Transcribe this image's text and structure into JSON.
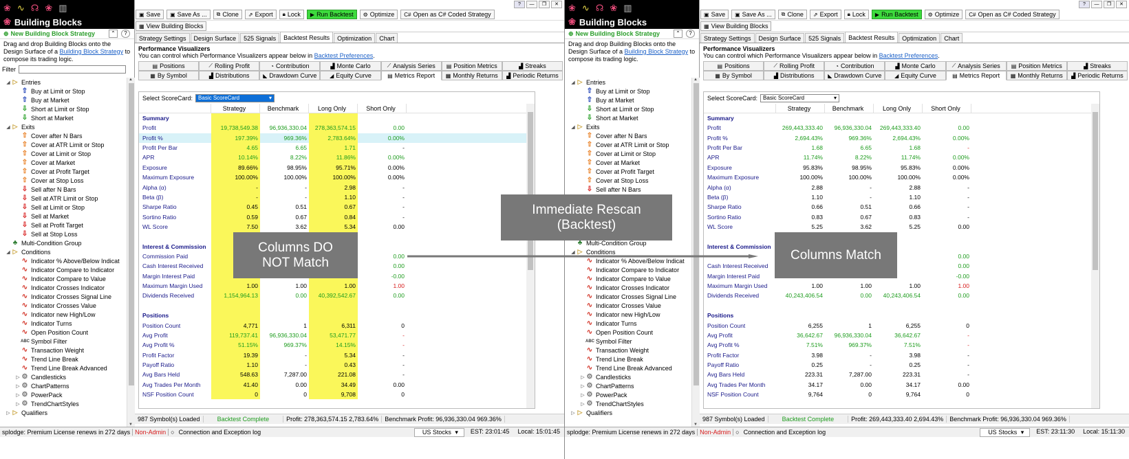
{
  "bb": {
    "title": "Building Blocks",
    "new_label": "New Building Block Strategy",
    "desc_pre": "Drag and drop Building Blocks onto the Design Surface of a ",
    "desc_link": "Building Block Strategy",
    "desc_post": " to compose its trading logic.",
    "filter_label": "Filter",
    "tree": [
      {
        "t": "Entries",
        "i": "folder",
        "e": "open",
        "l": 0
      },
      {
        "t": "Buy at Limit or Stop",
        "i": "up",
        "l": 1
      },
      {
        "t": "Buy at Market",
        "i": "up",
        "l": 1
      },
      {
        "t": "Short at Limit or Stop",
        "i": "dn",
        "l": 1
      },
      {
        "t": "Short at Market",
        "i": "dn",
        "l": 1
      },
      {
        "t": "Exits",
        "i": "folder",
        "e": "open",
        "l": 0
      },
      {
        "t": "Cover after N Bars",
        "i": "or",
        "l": 1
      },
      {
        "t": "Cover at ATR Limit or Stop",
        "i": "or",
        "l": 1
      },
      {
        "t": "Cover at Limit or Stop",
        "i": "or",
        "l": 1
      },
      {
        "t": "Cover at Market",
        "i": "or",
        "l": 1
      },
      {
        "t": "Cover at Profit Target",
        "i": "or",
        "l": 1
      },
      {
        "t": "Cover at Stop Loss",
        "i": "or",
        "l": 1
      },
      {
        "t": "Sell after N Bars",
        "i": "rd",
        "l": 1
      },
      {
        "t": "Sell at ATR Limit or Stop",
        "i": "rd",
        "l": 1
      },
      {
        "t": "Sell at Limit or Stop",
        "i": "rd",
        "l": 1
      },
      {
        "t": "Sell at Market",
        "i": "rd",
        "l": 1
      },
      {
        "t": "Sell at Profit Target",
        "i": "rd",
        "l": 1
      },
      {
        "t": "Sell at Stop Loss",
        "i": "rd",
        "l": 1
      },
      {
        "t": "Multi-Condition Group",
        "i": "gr",
        "l": 0
      },
      {
        "t": "Conditions",
        "i": "folder",
        "e": "open",
        "l": 0
      },
      {
        "t": "Indicator % Above/Below Indicat",
        "i": "sq",
        "l": 1
      },
      {
        "t": "Indicator Compare to Indicator",
        "i": "sq",
        "l": 1
      },
      {
        "t": "Indicator Compare to Value",
        "i": "sq",
        "l": 1
      },
      {
        "t": "Indicator Crosses Indicator",
        "i": "sq",
        "l": 1
      },
      {
        "t": "Indicator Crosses Signal Line",
        "i": "sq",
        "l": 1
      },
      {
        "t": "Indicator Crosses Value",
        "i": "sq",
        "l": 1
      },
      {
        "t": "Indicator new High/Low",
        "i": "sq",
        "l": 1
      },
      {
        "t": "Indicator Turns",
        "i": "sq",
        "l": 1
      },
      {
        "t": "Open Position Count",
        "i": "sq",
        "l": 1
      },
      {
        "t": "Symbol Filter",
        "i": "abc",
        "l": 1
      },
      {
        "t": "Transaction Weight",
        "i": "sq",
        "l": 1
      },
      {
        "t": "Trend Line Break",
        "i": "sq",
        "l": 1
      },
      {
        "t": "Trend Line Break Advanced",
        "i": "sq",
        "l": 1
      },
      {
        "t": "Candlesticks",
        "i": "gear",
        "e": "closed",
        "l": 1
      },
      {
        "t": "ChartPatterns",
        "i": "gear",
        "e": "closed",
        "l": 1
      },
      {
        "t": "PowerPack",
        "i": "gear",
        "e": "closed",
        "l": 1
      },
      {
        "t": "TrendChartStyles",
        "i": "gear",
        "e": "closed",
        "l": 1
      },
      {
        "t": "Qualifiers",
        "i": "folder",
        "e": "closed",
        "l": 0
      }
    ]
  },
  "toolbar": {
    "save": "Save",
    "save_as": "Save As ...",
    "clone": "Clone",
    "export": "Export",
    "lock": "Lock",
    "run": "Run Backtest",
    "optimize": "Optimize",
    "open_cs": "Open as C# Coded Strategy",
    "view_bb": "View Building Blocks"
  },
  "tabs": {
    "t0": "Strategy Settings",
    "t1": "Design Surface",
    "t2": "525 Signals",
    "t3": "Backtest Results",
    "t4": "Optimization",
    "t5": "Chart"
  },
  "pv": {
    "title": "Performance Visualizers",
    "desc_pre": "You can control which Performance Visualizers appear below in ",
    "desc_link": "Backtest Preferences",
    "desc_post": "."
  },
  "mtabs1": {
    "a": "Positions",
    "b": "Rolling Profit",
    "c": "Contribution",
    "d": "Monte Carlo",
    "e": "Analysis Series",
    "f": "Position Metrics",
    "g": "Streaks"
  },
  "mtabs2": {
    "a": "By Symbol",
    "b": "Distributions",
    "c": "Drawdown Curve",
    "d": "Equity Curve",
    "e": "Metrics Report",
    "f": "Monthly Returns",
    "g": "Periodic Returns"
  },
  "scorecard": {
    "label": "Select ScoreCard:",
    "value": "Basic ScoreCard"
  },
  "cols": {
    "c1": "Strategy",
    "c2": "Benchmark",
    "c3": "Long Only",
    "c4": "Short Only"
  },
  "rows_left": [
    {
      "n": "Summary",
      "s": 1
    },
    {
      "n": "Profit",
      "v": [
        "19,738,549.38",
        "96,936,330.04",
        "278,363,574.15",
        "0.00"
      ],
      "c": [
        "g",
        "g",
        "g",
        "g"
      ]
    },
    {
      "n": "Profit %",
      "v": [
        "197.39%",
        "969.36%",
        "2,783.64%",
        "0.00%"
      ],
      "c": [
        "g",
        "g",
        "g",
        "g"
      ]
    },
    {
      "n": "Profit Per Bar",
      "v": [
        "4.65",
        "6.65",
        "1.71",
        "-"
      ],
      "c": [
        "g",
        "g",
        "g",
        "k"
      ]
    },
    {
      "n": "APR",
      "v": [
        "10.14%",
        "8.22%",
        "11.86%",
        "0.00%"
      ],
      "c": [
        "g",
        "g",
        "g",
        "g"
      ]
    },
    {
      "n": "Exposure",
      "v": [
        "89.66%",
        "98.95%",
        "95.71%",
        "0.00%"
      ],
      "c": [
        "k",
        "k",
        "k",
        "k"
      ]
    },
    {
      "n": "Maximum Exposure",
      "v": [
        "100.00%",
        "100.00%",
        "100.00%",
        "0.00%"
      ],
      "c": [
        "k",
        "k",
        "k",
        "k"
      ]
    },
    {
      "n": "Alpha (α)",
      "v": [
        "-",
        "-",
        "2.98",
        "-"
      ],
      "c": [
        "k",
        "k",
        "k",
        "k"
      ]
    },
    {
      "n": "Beta (β)",
      "v": [
        "-",
        "-",
        "1.10",
        "-"
      ],
      "c": [
        "k",
        "k",
        "k",
        "k"
      ]
    },
    {
      "n": "Sharpe Ratio",
      "v": [
        "0.45",
        "0.51",
        "0.67",
        "-"
      ],
      "c": [
        "k",
        "k",
        "k",
        "k"
      ]
    },
    {
      "n": "Sortino Ratio",
      "v": [
        "0.59",
        "0.67",
        "0.84",
        "-"
      ],
      "c": [
        "k",
        "k",
        "k",
        "k"
      ]
    },
    {
      "n": "WL Score",
      "v": [
        "7.50",
        "3.62",
        "5.34",
        "0.00"
      ],
      "c": [
        "k",
        "k",
        "k",
        "k"
      ]
    },
    {
      "n": "",
      "b": 1
    },
    {
      "n": "Interest & Commission",
      "s": 1
    },
    {
      "n": "Commission Paid",
      "v": [
        "",
        "",
        "",
        "0.00"
      ],
      "c": [
        "g",
        "g",
        "g",
        "g"
      ]
    },
    {
      "n": "Cash Interest Received",
      "v": [
        "",
        "",
        "",
        "0.00"
      ],
      "c": [
        "g",
        "g",
        "g",
        "g"
      ]
    },
    {
      "n": "Margin Interest Paid",
      "v": [
        "",
        "",
        "",
        "-0.00"
      ],
      "c": [
        "g",
        "g",
        "g",
        "g"
      ]
    },
    {
      "n": "Maximum Margin Used",
      "v": [
        "1.00",
        "1.00",
        "1.00",
        "1.00"
      ],
      "c": [
        "k",
        "k",
        "k",
        "r"
      ]
    },
    {
      "n": "Dividends Received",
      "v": [
        "1,154,964.13",
        "0.00",
        "40,392,542.67",
        "0.00"
      ],
      "c": [
        "g",
        "g",
        "g",
        "g"
      ]
    },
    {
      "n": "",
      "b": 1
    },
    {
      "n": "Positions",
      "s": 1
    },
    {
      "n": "Position Count",
      "v": [
        "4,771",
        "1",
        "6,311",
        "0"
      ],
      "c": [
        "k",
        "k",
        "k",
        "k"
      ]
    },
    {
      "n": "Avg Profit",
      "v": [
        "119,737.41",
        "96,936,330.04",
        "53,471.77",
        "-"
      ],
      "c": [
        "g",
        "g",
        "g",
        "r"
      ]
    },
    {
      "n": "Avg Profit %",
      "v": [
        "51.15%",
        "969.37%",
        "14.15%",
        "-"
      ],
      "c": [
        "g",
        "g",
        "g",
        "r"
      ]
    },
    {
      "n": "Profit Factor",
      "v": [
        "19.39",
        "-",
        "5.34",
        "-"
      ],
      "c": [
        "k",
        "k",
        "k",
        "k"
      ]
    },
    {
      "n": "Payoff Ratio",
      "v": [
        "1.10",
        "-",
        "0.43",
        "-"
      ],
      "c": [
        "k",
        "k",
        "k",
        "k"
      ]
    },
    {
      "n": "Avg Bars Held",
      "v": [
        "548.63",
        "7,287.00",
        "221.08",
        "-"
      ],
      "c": [
        "k",
        "k",
        "k",
        "k"
      ]
    },
    {
      "n": "Avg Trades Per Month",
      "v": [
        "41.40",
        "0.00",
        "34.49",
        "0.00"
      ],
      "c": [
        "k",
        "k",
        "k",
        "k"
      ]
    },
    {
      "n": "NSF Position Count",
      "v": [
        "0",
        "0",
        "9,708",
        "0"
      ],
      "c": [
        "k",
        "k",
        "k",
        "k"
      ]
    }
  ],
  "rows_right": [
    {
      "n": "Summary",
      "s": 1
    },
    {
      "n": "Profit",
      "v": [
        "269,443,333.40",
        "96,936,330.04",
        "269,443,333.40",
        "0.00"
      ],
      "c": [
        "g",
        "g",
        "g",
        "g"
      ]
    },
    {
      "n": "Profit %",
      "v": [
        "2,694.43%",
        "969.36%",
        "2,694.43%",
        "0.00%"
      ],
      "c": [
        "g",
        "g",
        "g",
        "g"
      ]
    },
    {
      "n": "Profit Per Bar",
      "v": [
        "1.68",
        "6.65",
        "1.68",
        "-"
      ],
      "c": [
        "g",
        "g",
        "g",
        "r"
      ]
    },
    {
      "n": "APR",
      "v": [
        "11.74%",
        "8.22%",
        "11.74%",
        "0.00%"
      ],
      "c": [
        "g",
        "g",
        "g",
        "g"
      ]
    },
    {
      "n": "Exposure",
      "v": [
        "95.83%",
        "98.95%",
        "95.83%",
        "0.00%"
      ],
      "c": [
        "k",
        "k",
        "k",
        "k"
      ]
    },
    {
      "n": "Maximum Exposure",
      "v": [
        "100.00%",
        "100.00%",
        "100.00%",
        "0.00%"
      ],
      "c": [
        "k",
        "k",
        "k",
        "k"
      ]
    },
    {
      "n": "Alpha (α)",
      "v": [
        "2.88",
        "-",
        "2.88",
        "-"
      ],
      "c": [
        "k",
        "k",
        "k",
        "k"
      ]
    },
    {
      "n": "Beta (β)",
      "v": [
        "1.10",
        "-",
        "1.10",
        "-"
      ],
      "c": [
        "k",
        "k",
        "k",
        "k"
      ]
    },
    {
      "n": "Sharpe Ratio",
      "v": [
        "0.66",
        "0.51",
        "0.66",
        "-"
      ],
      "c": [
        "k",
        "k",
        "k",
        "k"
      ]
    },
    {
      "n": "Sortino Ratio",
      "v": [
        "0.83",
        "0.67",
        "0.83",
        "-"
      ],
      "c": [
        "k",
        "k",
        "k",
        "k"
      ]
    },
    {
      "n": "WL Score",
      "v": [
        "5.25",
        "3.62",
        "5.25",
        "0.00"
      ],
      "c": [
        "k",
        "k",
        "k",
        "k"
      ]
    },
    {
      "n": "",
      "b": 1
    },
    {
      "n": "Interest & Commission",
      "s": 1
    },
    {
      "n": "",
      "v": [
        "",
        "",
        "",
        "0.00"
      ],
      "c": [
        "g",
        "g",
        "g",
        "g"
      ]
    },
    {
      "n": "Cash Interest Received",
      "v": [
        "",
        "",
        "",
        "0.00"
      ],
      "c": [
        "g",
        "g",
        "g",
        "g"
      ]
    },
    {
      "n": "Margin Interest Paid",
      "v": [
        "",
        "",
        "",
        "-0.00"
      ],
      "c": [
        "g",
        "g",
        "g",
        "g"
      ]
    },
    {
      "n": "Maximum Margin Used",
      "v": [
        "1.00",
        "1.00",
        "1.00",
        "1.00"
      ],
      "c": [
        "k",
        "k",
        "k",
        "r"
      ]
    },
    {
      "n": "Dividends Received",
      "v": [
        "40,243,406.54",
        "0.00",
        "40,243,406.54",
        "0.00"
      ],
      "c": [
        "g",
        "g",
        "g",
        "g"
      ]
    },
    {
      "n": "",
      "b": 1
    },
    {
      "n": "Positions",
      "s": 1
    },
    {
      "n": "Position Count",
      "v": [
        "6,255",
        "1",
        "6,255",
        "0"
      ],
      "c": [
        "k",
        "k",
        "k",
        "k"
      ]
    },
    {
      "n": "Avg Profit",
      "v": [
        "36,642.67",
        "96,936,330.04",
        "36,642.67",
        "-"
      ],
      "c": [
        "g",
        "g",
        "g",
        "r"
      ]
    },
    {
      "n": "Avg Profit %",
      "v": [
        "7.51%",
        "969.37%",
        "7.51%",
        "-"
      ],
      "c": [
        "g",
        "g",
        "g",
        "r"
      ]
    },
    {
      "n": "Profit Factor",
      "v": [
        "3.98",
        "-",
        "3.98",
        "-"
      ],
      "c": [
        "k",
        "k",
        "k",
        "k"
      ]
    },
    {
      "n": "Payoff Ratio",
      "v": [
        "0.25",
        "-",
        "0.25",
        "-"
      ],
      "c": [
        "k",
        "k",
        "k",
        "k"
      ]
    },
    {
      "n": "Avg Bars Held",
      "v": [
        "223.31",
        "7,287.00",
        "223.31",
        "-"
      ],
      "c": [
        "k",
        "k",
        "k",
        "k"
      ]
    },
    {
      "n": "Avg Trades Per Month",
      "v": [
        "34.17",
        "0.00",
        "34.17",
        "0.00"
      ],
      "c": [
        "k",
        "k",
        "k",
        "k"
      ]
    },
    {
      "n": "NSF Position Count",
      "v": [
        "9,764",
        "0",
        "9,764",
        "0"
      ],
      "c": [
        "k",
        "k",
        "k",
        "k"
      ]
    }
  ],
  "status_left": {
    "symbols": "987 Symbol(s) Loaded",
    "state": "Backtest Complete",
    "profit": "Profit: 278,363,574.15  2,783.64%",
    "bench": "Benchmark Profit: 96,936,330.04  969.36%"
  },
  "status_right": {
    "symbols": "987 Symbol(s) Loaded",
    "state": "Backtest Complete",
    "profit": "Profit: 269,443,333.40  2,694.43%",
    "bench": "Benchmark Profit: 96,936,330.04  969.36%"
  },
  "bottom_left": {
    "license": "splodge: Premium License renews in 272 days",
    "admin": "Non-Admin",
    "log": "Connection and Exception log",
    "market": "US Stocks",
    "est": "EST: 23:01:45",
    "local": "Local: 15:01:45"
  },
  "bottom_right": {
    "license": "splodge: Premium License renews in 272 days",
    "admin": "Non-Admin",
    "log": "Connection and Exception log",
    "market": "US Stocks",
    "est": "EST: 23:11:30",
    "local": "Local: 15:11:30"
  },
  "overlays": {
    "notmatch_1": "Columns DO",
    "notmatch_2": "NOT Match",
    "rescan_1": "Immediate Rescan",
    "rescan_2": "(Backtest)",
    "match": "Columns Match"
  },
  "colors": {
    "highlight": "#faf75a",
    "positive": "#1e9c1e",
    "negative": "#d71b1b",
    "run": "#3ddb3d",
    "overlay": "#787878"
  }
}
